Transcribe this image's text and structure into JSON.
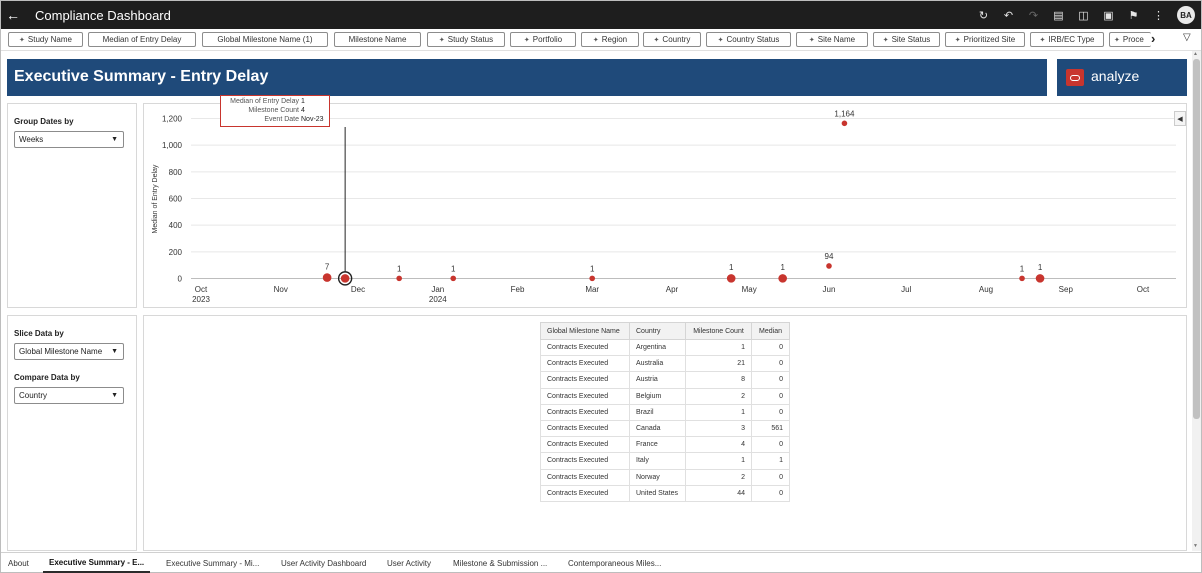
{
  "header": {
    "title": "Compliance Dashboard",
    "avatar_initials": "BA",
    "back_icon": "back-arrow-icon",
    "toolbar_icons": [
      "refresh-icon",
      "undo-icon",
      "redo-icon",
      "data-icon",
      "comment-icon",
      "present-icon",
      "bookmark-icon",
      "more-icon"
    ]
  },
  "filters": [
    "Study Name",
    "Median of Entry Delay",
    "Global Milestone Name (1)",
    "Milestone Name",
    "Study Status",
    "Portfolio",
    "Region",
    "Country",
    "Country Status",
    "Site Name",
    "Site Status",
    "Prioritized Site",
    "IRB/EC Type",
    "Proce"
  ],
  "banner": {
    "title": "Executive Summary - Entry Delay",
    "logo_text": "analyze",
    "color": "#1f4a7a",
    "logo_color": "#c8352e"
  },
  "controls": {
    "group_dates_label": "Group Dates by",
    "group_dates_value": "Weeks",
    "slice_label": "Slice Data by",
    "slice_value": "Global Milestone Name",
    "compare_label": "Compare Data by",
    "compare_value": "Country"
  },
  "tooltip": {
    "rows": [
      {
        "key": "Median of Entry Delay",
        "value": "1"
      },
      {
        "key": "Milestone Count",
        "value": "4"
      },
      {
        "key": "Event Date",
        "value": "Nov-23"
      }
    ]
  },
  "chart_data": {
    "type": "scatter",
    "title": "",
    "xlabel": "",
    "ylabel": "Median of Entry Delay",
    "ylim": [
      0,
      1200
    ],
    "yticks": [
      "0",
      "200",
      "400",
      "600",
      "800",
      "1,000",
      "1,200"
    ],
    "xtick_labels": [
      {
        "label": "Oct",
        "sub": "2023"
      },
      {
        "label": "Nov",
        "sub": ""
      },
      {
        "label": "Dec",
        "sub": ""
      },
      {
        "label": "Jan",
        "sub": "2024"
      },
      {
        "label": "Feb",
        "sub": ""
      },
      {
        "label": "Mar",
        "sub": ""
      },
      {
        "label": "Apr",
        "sub": ""
      },
      {
        "label": "May",
        "sub": ""
      },
      {
        "label": "Jun",
        "sub": ""
      },
      {
        "label": "Jul",
        "sub": ""
      },
      {
        "label": "Aug",
        "sub": ""
      },
      {
        "label": "Sep",
        "sub": ""
      },
      {
        "label": "Oct",
        "sub": ""
      }
    ],
    "grid": true,
    "color": "#c8352e",
    "points": [
      {
        "date": "2023-11-19",
        "y": 7,
        "label": "7",
        "size": "large"
      },
      {
        "date": "2023-11-26",
        "y": 1,
        "label": "",
        "size": "large",
        "selected": true
      },
      {
        "date": "2023-12-17",
        "y": 1,
        "label": "1",
        "size": "small"
      },
      {
        "date": "2024-01-07",
        "y": 1,
        "label": "1",
        "size": "small"
      },
      {
        "date": "2024-03-01",
        "y": 1,
        "label": "1",
        "size": "small"
      },
      {
        "date": "2024-04-24",
        "y": 1,
        "label": "1",
        "size": "large"
      },
      {
        "date": "2024-05-14",
        "y": 1,
        "label": "1",
        "size": "large"
      },
      {
        "date": "2024-06-01",
        "y": 94,
        "label": "94",
        "size": "small"
      },
      {
        "date": "2024-06-07",
        "y": 1164,
        "label": "1,164",
        "size": "small"
      },
      {
        "date": "2024-08-15",
        "y": 1,
        "label": "1",
        "size": "small"
      },
      {
        "date": "2024-08-22",
        "y": 1,
        "label": "1",
        "size": "large"
      }
    ]
  },
  "table": {
    "headers": [
      "Global Milestone Name",
      "Country",
      "Milestone Count",
      "Median"
    ],
    "rows": [
      [
        "Contracts Executed",
        "Argentina",
        "1",
        "0"
      ],
      [
        "Contracts Executed",
        "Australia",
        "21",
        "0"
      ],
      [
        "Contracts Executed",
        "Austria",
        "8",
        "0"
      ],
      [
        "Contracts Executed",
        "Belgium",
        "2",
        "0"
      ],
      [
        "Contracts Executed",
        "Brazil",
        "1",
        "0"
      ],
      [
        "Contracts Executed",
        "Canada",
        "3",
        "561"
      ],
      [
        "Contracts Executed",
        "France",
        "4",
        "0"
      ],
      [
        "Contracts Executed",
        "Italy",
        "1",
        "1"
      ],
      [
        "Contracts Executed",
        "Norway",
        "2",
        "0"
      ],
      [
        "Contracts Executed",
        "United States",
        "44",
        "0"
      ]
    ]
  },
  "tabs": [
    {
      "label": "About",
      "active": false
    },
    {
      "label": "Executive Summary - E...",
      "active": true
    },
    {
      "label": "Executive Summary - Mi...",
      "active": false
    },
    {
      "label": "User Activity Dashboard",
      "active": false
    },
    {
      "label": "User Activity",
      "active": false
    },
    {
      "label": "Milestone & Submission ...",
      "active": false
    },
    {
      "label": "Contemporaneous Miles...",
      "active": false
    }
  ]
}
